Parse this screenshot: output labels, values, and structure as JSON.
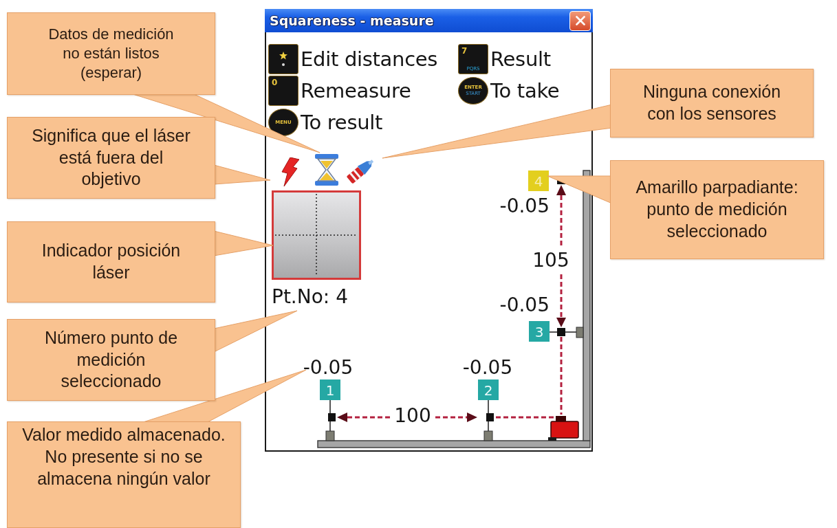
{
  "window": {
    "title": "Squareness - measure"
  },
  "menu": [
    {
      "kind": "icon",
      "label": "Edit distances"
    },
    {
      "kind": "square",
      "key_text": [
        "7",
        "PQRS"
      ],
      "label": "Result"
    },
    {
      "kind": "square",
      "key_text": [
        "0"
      ],
      "label": "Remeasure"
    },
    {
      "kind": "round",
      "key_text": [
        "ENTER",
        "START"
      ],
      "label": "To take"
    },
    {
      "kind": "round",
      "key_text": [
        "MENU"
      ],
      "label": "To result"
    }
  ],
  "point_number": "Pt.No: 4",
  "diagram": {
    "points": [
      {
        "label": "4",
        "value": "-0.05",
        "selected": true
      },
      {
        "label": "3",
        "value": "-0.05",
        "selected": false
      },
      {
        "label": "1",
        "value": "-0.05",
        "selected": false
      },
      {
        "label": "2",
        "value": "-0.05",
        "selected": false
      }
    ],
    "distances": [
      "105",
      "100"
    ]
  },
  "callouts": [
    {
      "text": "Datos de medición\nno están listos\n(esperar)"
    },
    {
      "text": "Significa que el láser\nestá fuera del\nobjetivo"
    },
    {
      "text": "Indicador posición\nláser"
    },
    {
      "text": "Número punto de\nmedición\nseleccionado"
    },
    {
      "text": "Valor medido almacenado.\nNo presente si no se\nalmacena ningún valor"
    },
    {
      "text": "Ninguna conexión\ncon los sensores"
    },
    {
      "text": "Amarillo parpadiante:\npunto de medición\nseleccionado"
    }
  ]
}
